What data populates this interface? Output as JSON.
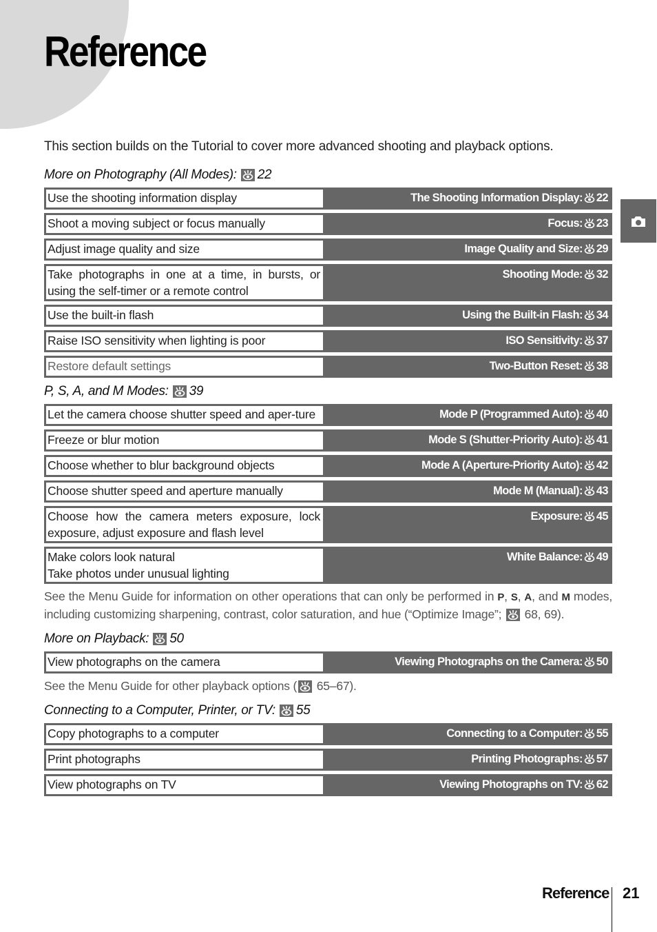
{
  "page": {
    "title": "Reference",
    "intro": "This section builds on the Tutorial to cover more advanced shooting and playback options.",
    "side_tab_icon": "camera-icon",
    "footer": {
      "section": "Reference",
      "page_number": "21"
    }
  },
  "colors": {
    "bar": "#666666",
    "circle": "#d9d9d9",
    "text": "#1a1a1a"
  },
  "sections": [
    {
      "heading": "More on Photography (All Modes):",
      "heading_page": "22",
      "rows": [
        {
          "task": "Use the shooting information display",
          "ref": "The Shooting Information Display:",
          "page": "22"
        },
        {
          "task": "Shoot a moving subject or focus manually",
          "ref": "Focus:",
          "page": "23"
        },
        {
          "task": "Adjust image quality and size",
          "ref": "Image Quality and Size:",
          "page": "29"
        },
        {
          "task": "Take photographs in one at a time, in bursts, or using the self-timer or a remote control",
          "ref": "Shooting Mode:",
          "page": "32"
        },
        {
          "task": "Use the built-in flash",
          "ref": "Using the Built-in Flash:",
          "page": "34"
        },
        {
          "task": "Raise ISO sensitivity when lighting is poor",
          "ref": "ISO Sensitivity:",
          "page": "37"
        },
        {
          "task": "Restore default settings",
          "ref": "Two-Button Reset:",
          "page": "38"
        }
      ]
    },
    {
      "heading": "P, S, A, and M Modes:",
      "heading_page": "39",
      "rows": [
        {
          "task": "Let the camera choose shutter speed and aper-ture",
          "ref": "Mode P (Programmed Auto):",
          "page": "40"
        },
        {
          "task": "Freeze or blur motion",
          "ref": "Mode S (Shutter-Priority Auto):",
          "page": "41"
        },
        {
          "task": "Choose whether to blur background objects",
          "ref": "Mode A (Aperture-Priority Auto):",
          "page": "42"
        },
        {
          "task": "Choose shutter speed and aperture manually",
          "ref": "Mode M (Manual):",
          "page": "43"
        },
        {
          "task": "Choose how the camera meters exposure, lock exposure, adjust exposure and flash level",
          "ref": "Exposure:",
          "page": "45"
        },
        {
          "task": "Make colors look natural",
          "task_line2": "Take photos under unusual lighting",
          "ref": "White Balance:",
          "page": "49"
        }
      ],
      "note": {
        "part1": "See the Menu Guide for information on other operations that can only be performed in ",
        "mode_p": "P",
        "sep1": ", ",
        "mode_s": "S",
        "sep2": ", ",
        "mode_a": "A",
        "sep3": ", and ",
        "mode_m": "M",
        "part2": " modes, including customizing sharpening, contrast, color saturation, and hue (“Optimize Image”; ",
        "part3": " 68, 69)."
      }
    },
    {
      "heading": "More on Playback:",
      "heading_page": "50",
      "rows": [
        {
          "task": "View photographs on the camera",
          "ref": "Viewing Photographs on the Camera:",
          "page": "50"
        }
      ],
      "note": {
        "part1": "See the Menu Guide for other playback options (",
        "part2": " 65–67)."
      }
    },
    {
      "heading": "Connecting to a Computer, Printer, or TV:",
      "heading_page": "55",
      "rows": [
        {
          "task": "Copy photographs to a computer",
          "ref": "Connecting to a Computer:",
          "page": "55"
        },
        {
          "task": "Print photographs",
          "ref": "Printing Photographs:",
          "page": "57"
        },
        {
          "task": "View photographs on TV",
          "ref": "Viewing Photographs on TV:",
          "page": "62"
        }
      ]
    }
  ]
}
